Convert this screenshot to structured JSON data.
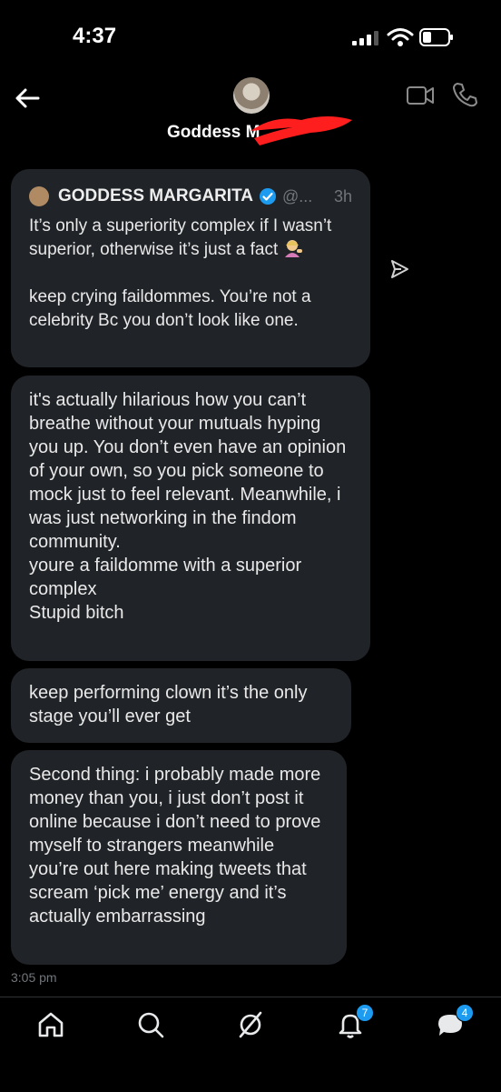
{
  "status_bar": {
    "time": "4:37"
  },
  "header": {
    "contact_name": "Goddess M"
  },
  "quoted_post": {
    "author": "GODDESS MARGARITA",
    "handle": "@...",
    "time": "3h",
    "line1": "It’s only a superiority complex if I wasn’t superior, otherwise it’s just a fact",
    "line2": "keep crying faildommes. You’re not a celebrity Bc you don’t look like one."
  },
  "messages": [
    {
      "text": "it's actually hilarious how you can’t breathe without your mutuals hyping you up. You don’t even have an opinion of your own, so you pick someone to mock just to feel relevant. Meanwhile, i was just networking in the findom community.\nyoure a faildomme with a superior complex\nStupid bitch"
    },
    {
      "text": "keep performing clown it’s the only stage you’ll ever get"
    },
    {
      "text": "Second thing: i probably made more money than you, i just don’t post it online because i don’t need to prove myself to strangers meanwhile you’re out here making tweets that scream ‘pick me’ energy and it’s actually embarrassing"
    }
  ],
  "timestamp": "3:05 pm",
  "tabbar": {
    "items": [
      {
        "icon": "home-icon"
      },
      {
        "icon": "search-icon"
      },
      {
        "icon": "grok-icon"
      },
      {
        "icon": "bell-icon",
        "badge": "7"
      },
      {
        "icon": "messages-icon",
        "badge": "4"
      }
    ]
  },
  "colors": {
    "bubble": "#202327",
    "accent": "#1d9bf0",
    "muted": "#71767b"
  }
}
